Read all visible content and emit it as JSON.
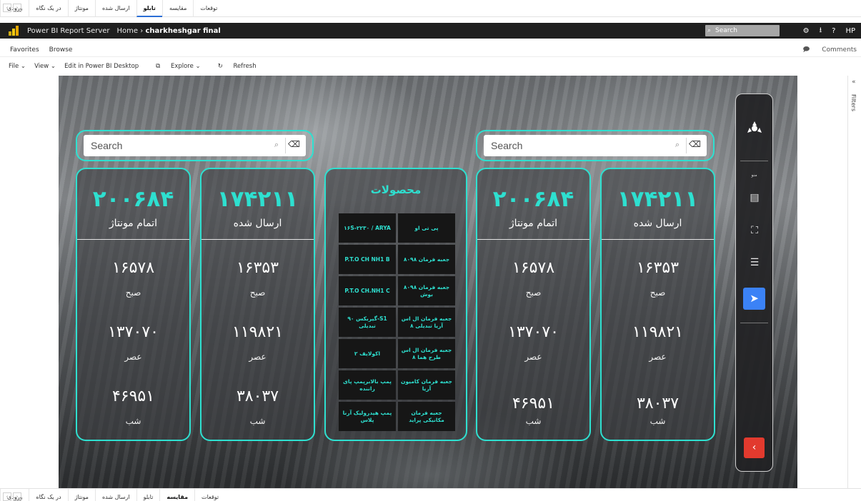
{
  "page_tabs": {
    "items": [
      "توقعات",
      "مقایسه",
      "تابلو",
      "ارسال شده",
      "مونتاژ",
      "در یک نگاه",
      "ورودی"
    ],
    "active_top": "تابلو",
    "active_bottom": "مقایسه"
  },
  "header": {
    "app_title": "Power BI Report Server",
    "breadcrumb_home": "Home",
    "breadcrumb_sep": "›",
    "report_name": "charkheshgar final",
    "search_placeholder": "Search",
    "user": "HP"
  },
  "nav": {
    "favorites": "Favorites",
    "browse": "Browse",
    "comments": "Comments"
  },
  "toolbar": {
    "file": "File ⌄",
    "view": "View ⌄",
    "edit": "Edit in Power BI Desktop",
    "explore": "Explore ⌄",
    "refresh": "Refresh"
  },
  "filters_label": "Filters",
  "search_left": {
    "placeholder": "Search"
  },
  "search_right": {
    "placeholder": "Search"
  },
  "cards": [
    {
      "big": "۲۰۰۶۸۴",
      "big_label": "اتمام مونتاژ",
      "v1": "۱۶۵۷۸",
      "l1": "صبح",
      "v2": "۱۳۷۰۷۰",
      "l2": "عصر",
      "v3": "۴۶۹۵۱",
      "l3": "شب"
    },
    {
      "big": "۱۷۴۲۱۱",
      "big_label": "ارسال شده",
      "v1": "۱۶۳۵۳",
      "l1": "صبح",
      "v2": "۱۱۹۸۲۱",
      "l2": "عصر",
      "v3": "۳۸۰۳۷",
      "l3": "شب"
    },
    {
      "big": "۲۰۰۶۸۴",
      "big_label": "اتمام مونتاژ",
      "v1": "۱۶۵۷۸",
      "l1": "صبح",
      "v2": "۱۳۷۰۷۰",
      "l2": "عصر",
      "v3": "۴۶۹۵۱",
      "l3": "شب"
    },
    {
      "big": "۱۷۴۲۱۱",
      "big_label": "ارسال شده",
      "v1": "۱۶۳۵۳",
      "l1": "صبح",
      "v2": "۱۱۹۸۲۱",
      "l2": "عصر",
      "v3": "۳۸۰۳۷",
      "l3": "شب"
    }
  ],
  "products": {
    "title": "محصولات",
    "items": [
      "۱۶S-۲۲۳۰ / ARYA",
      "پی تی او",
      "P.T.O CH NH1 B",
      "جعبه فرمان ۸۰۹۸",
      "P.T.O CH.NH1 C",
      "جعبه فرمان ۸۰۹۸ بوش",
      "گیربکس ۹۰-S1 تبدیلی",
      "جعبه فرمان ال اس آریا تبدیلی ۸",
      "اکولایف ۲",
      "جعبه فرمان ال اس طرح هما ۸",
      "پمپ بالابرپمپ پای راننده",
      "جعبه فرمان کامیون آریا",
      "پمپ هیدرولیک آرنا پلاس",
      "جعبه فرمان مکانیکی پراید"
    ]
  },
  "side_menu": {
    "menu_label": "منو"
  },
  "colors": {
    "accent": "#2ee0d0",
    "send_button": "#3b82f6",
    "back_button": "#e23a2e",
    "header_bg": "#1f1f1f"
  }
}
